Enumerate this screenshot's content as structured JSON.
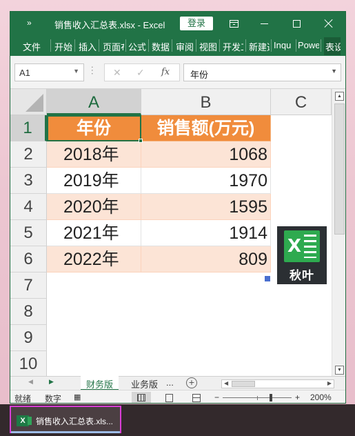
{
  "titlebar": {
    "qat_glyph": "»",
    "title": "销售收入汇总表.xlsx  -  Excel",
    "login": "登录"
  },
  "ribbon": {
    "tabs": [
      "文件",
      "开始",
      "插入",
      "页面布",
      "公式",
      "数据",
      "审阅",
      "视图",
      "开发工",
      "新建选",
      "Inqu",
      "Powe",
      "表设"
    ]
  },
  "formula_bar": {
    "name_box": "A1",
    "formula": "年份"
  },
  "grid": {
    "columns": [
      "A",
      "B",
      "C"
    ],
    "rows": [
      "1",
      "2",
      "3",
      "4",
      "5",
      "6",
      "7",
      "8",
      "9",
      "10"
    ]
  },
  "table": {
    "headers": [
      "年份",
      "销售额(万元)"
    ],
    "rows": [
      [
        "2018年",
        "1068"
      ],
      [
        "2019年",
        "1970"
      ],
      [
        "2020年",
        "1595"
      ],
      [
        "2021年",
        "1914"
      ],
      [
        "2022年",
        "809"
      ]
    ]
  },
  "logo": {
    "brand": "秋叶"
  },
  "sheets": {
    "tabs": [
      "财务版",
      "业务版"
    ],
    "more": "..."
  },
  "status": {
    "ready": "就绪",
    "num_lock": "数字",
    "zoom": "200%",
    "zoom_minus": "−",
    "zoom_plus": "+"
  },
  "taskbar": {
    "app_label": "销售收入汇总表.xls..."
  },
  "colors": {
    "excel_green": "#217346",
    "header_orange": "#f08c3c",
    "band_peach": "#fce4d6"
  }
}
